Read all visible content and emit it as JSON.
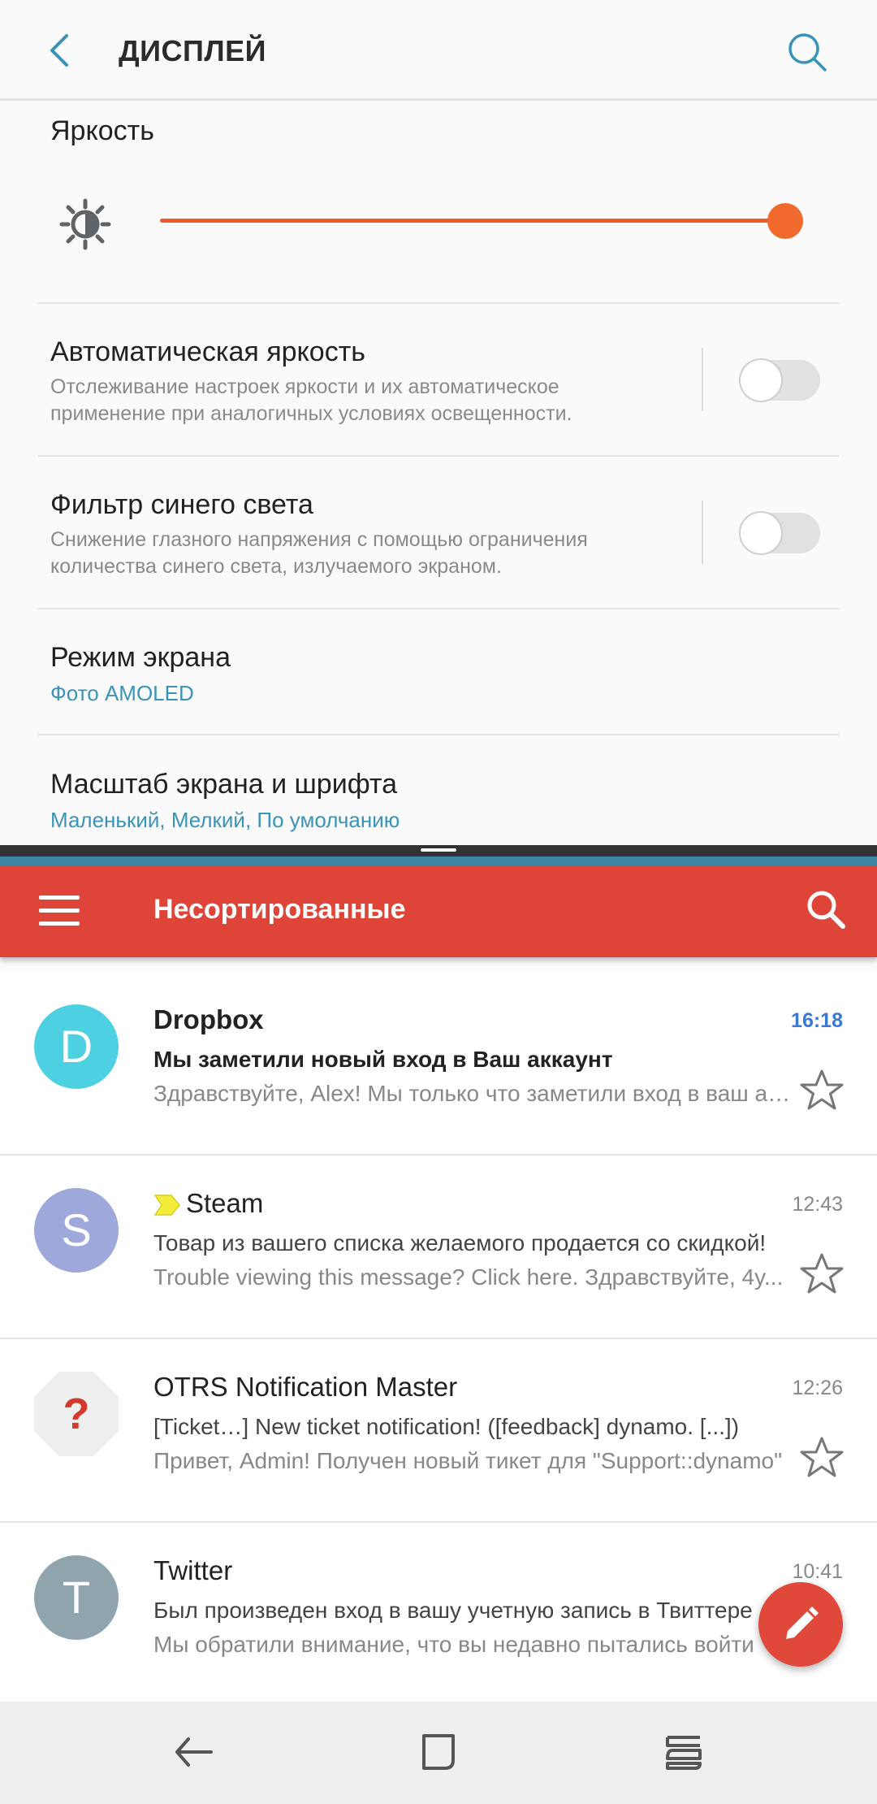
{
  "settings": {
    "title": "ДИСПЛЕЙ",
    "brightness": {
      "label": "Яркость",
      "level_percent": 100
    },
    "auto_brightness": {
      "title": "Автоматическая яркость",
      "description": "Отслеживание настроек яркости и их автоматическое применение при аналогичных условиях освещенности.",
      "enabled": false
    },
    "blue_light_filter": {
      "title": "Фильтр синего света",
      "description": "Снижение глазного напряжения с помощью ограничения количества синего света, излучаемого экраном.",
      "enabled": false
    },
    "screen_mode": {
      "title": "Режим экрана",
      "value": "Фото AMOLED"
    },
    "screen_zoom": {
      "title": "Масштаб экрана и шрифта",
      "value": "Маленький, Мелкий, По умолчанию"
    }
  },
  "mail": {
    "folder_title": "Несортированные",
    "messages": [
      {
        "avatar_letter": "D",
        "avatar_color": "#4dd0e1",
        "sender": "Dropbox",
        "time": "16:18",
        "unread": true,
        "subject": "Мы заметили новый вход в Ваш аккаунт",
        "preview": "Здравствуйте, Alex! Мы только что заметили вход в ваш аккаунт"
      },
      {
        "avatar_letter": "S",
        "avatar_color": "#9fa8da",
        "sender": "Steam",
        "time": "12:43",
        "unread": false,
        "subject": "Товар из вашего списка желаемого продается со скидкой!",
        "preview": "Trouble viewing this message? Click here. Здравствуйте, 4y..."
      },
      {
        "avatar_letter": "?",
        "avatar_color": "#eeeeee",
        "sender": "OTRS Notification Master",
        "time": "12:26",
        "unread": false,
        "subject": "[Ticket…] New ticket notification! ([feedback] dynamo. [...])",
        "preview": "Привет, Admin! Получен новый тикет для \"Support::dynamo\""
      },
      {
        "avatar_letter": "T",
        "avatar_color": "#90a4ae",
        "sender": "Twitter",
        "time": "10:41",
        "unread": false,
        "subject": "Был произведен вход в вашу учетную запись в Твиттере",
        "preview": "Мы обратили внимание, что вы недавно пытались войти"
      }
    ]
  },
  "colors": {
    "accent_orange": "#f06a2e",
    "mail_red": "#de4437",
    "link_blue": "#3a93b8",
    "unread_time_blue": "#3a78d6"
  }
}
